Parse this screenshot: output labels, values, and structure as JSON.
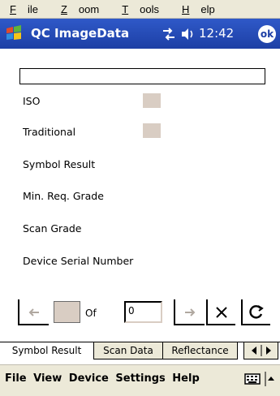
{
  "top_menu": {
    "items": [
      {
        "label": "File",
        "hotkey": "F",
        "rest": "ile"
      },
      {
        "label": "Zoom",
        "hotkey": "Z",
        "rest": "oom"
      },
      {
        "label": "Tools",
        "hotkey": "T",
        "rest": "ools"
      },
      {
        "label": "Help",
        "hotkey": "H",
        "rest": "elp"
      }
    ]
  },
  "titlebar": {
    "app_title": "QC ImageData",
    "time": "12:42",
    "ok_label": "ok",
    "colors": {
      "bar": "#1d3fa5",
      "text": "#ffffff"
    }
  },
  "form": {
    "text_value": "",
    "labels": {
      "iso": "ISO",
      "traditional": "Traditional",
      "symbol_result": "Symbol Result",
      "min_req_grade": "Min. Req. Grade",
      "scan_grade": "Scan Grade",
      "device_serial": "Device Serial Number"
    },
    "status_color": "#d9cdc3"
  },
  "navigator": {
    "current": "",
    "of_label": "Of",
    "total": "0",
    "prev_icon": "arrow-left-icon",
    "next_icon": "arrow-right-icon",
    "close_icon": "x-icon",
    "refresh_icon": "refresh-icon"
  },
  "tabs": {
    "items": [
      "Symbol Result",
      "Scan Data",
      "Reflectance"
    ],
    "active_index": 0
  },
  "bottom_menu": {
    "items": [
      "File",
      "View",
      "Device",
      "Settings",
      "Help"
    ]
  }
}
